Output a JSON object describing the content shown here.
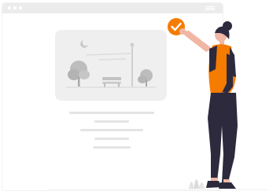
{
  "illustration": {
    "kind": "woman-checking-off-webpage",
    "icons": [
      "browser-window-icon",
      "landscape-image-icon",
      "checkmark-icon"
    ],
    "colors": {
      "accent": "#f57c00",
      "skin": "#f1b6a4",
      "outfit": "#2d2a3e",
      "placeholder": "#e6e6e6",
      "window_bar": "#ececec"
    }
  }
}
